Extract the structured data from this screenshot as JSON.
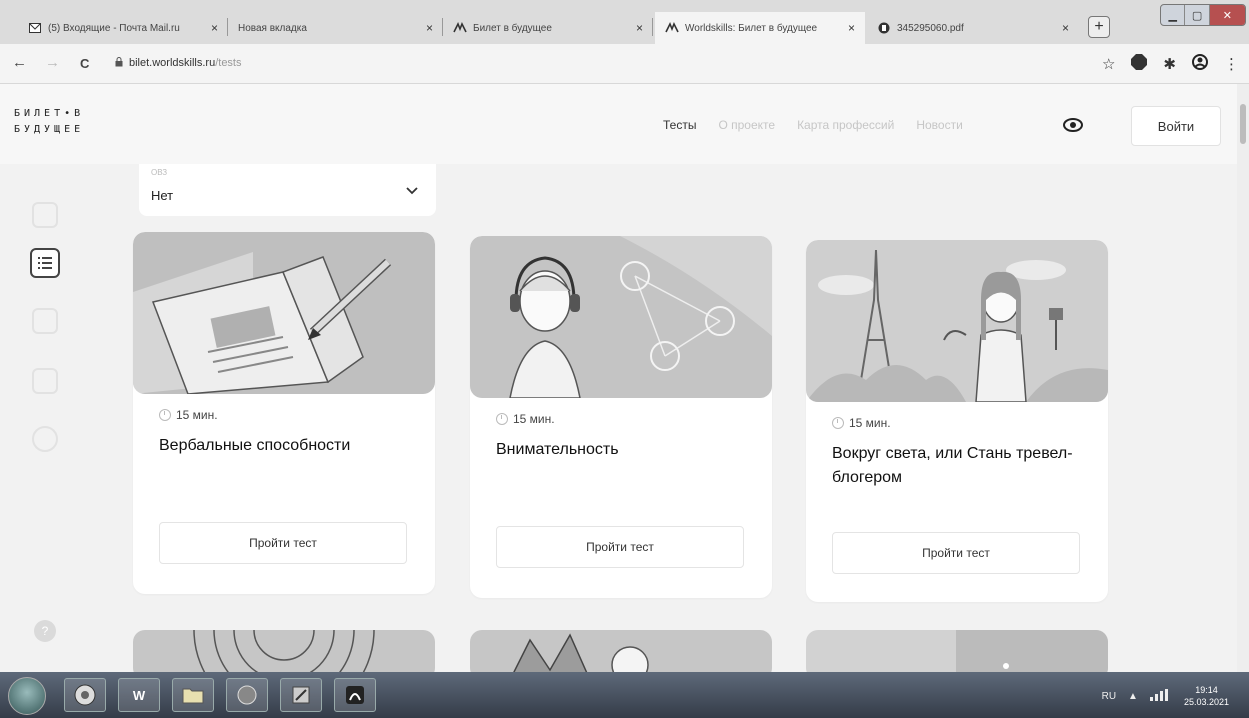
{
  "browser": {
    "tabs": [
      {
        "label": "(5) Входящие - Почта Mail.ru",
        "icon": "mail-icon"
      },
      {
        "label": "Новая вкладка",
        "icon": ""
      },
      {
        "label": "Билет в будущее",
        "icon": "worldskills-icon"
      },
      {
        "label": "Worldskills: Билет в будущее",
        "icon": "worldskills-icon"
      },
      {
        "label": "345295060.pdf",
        "icon": "pdf-icon"
      }
    ],
    "close_glyph": "×",
    "new_tab_glyph": "+",
    "url_host": "bilet.worldskills.ru",
    "url_path": "/tests",
    "back_glyph": "←",
    "forward_glyph": "→",
    "reload_glyph": "C"
  },
  "site": {
    "logo_line1": "БИЛЕТ•В",
    "logo_line2": "БУДУЩЕЕ",
    "nav": [
      {
        "label": "Тесты",
        "active": true
      },
      {
        "label": "О проекте",
        "active": false
      },
      {
        "label": "Карта профессий",
        "active": false
      },
      {
        "label": "Новости",
        "active": false
      }
    ],
    "login_label": "Войти",
    "filter": {
      "label": "ОВЗ",
      "value": "Нет"
    }
  },
  "cards": [
    {
      "duration": "15 мин.",
      "title": "Вербальные способности",
      "button": "Пройти тест"
    },
    {
      "duration": "15 мин.",
      "title": "Внимательность",
      "button": "Пройти тест"
    },
    {
      "duration": "15 мин.",
      "title": "Вокруг света, или Стань тревел-блогером",
      "button": "Пройти тест"
    }
  ],
  "taskbar": {
    "lang": "RU",
    "time": "19:14",
    "date": "25.03.2021"
  },
  "colors": {
    "page_bg": "#f2f2f2",
    "card_bg": "#ffffff",
    "illustration_gray": "#bdbdbd",
    "accent_text": "#222222",
    "muted_nav": "#c6c6c6"
  }
}
